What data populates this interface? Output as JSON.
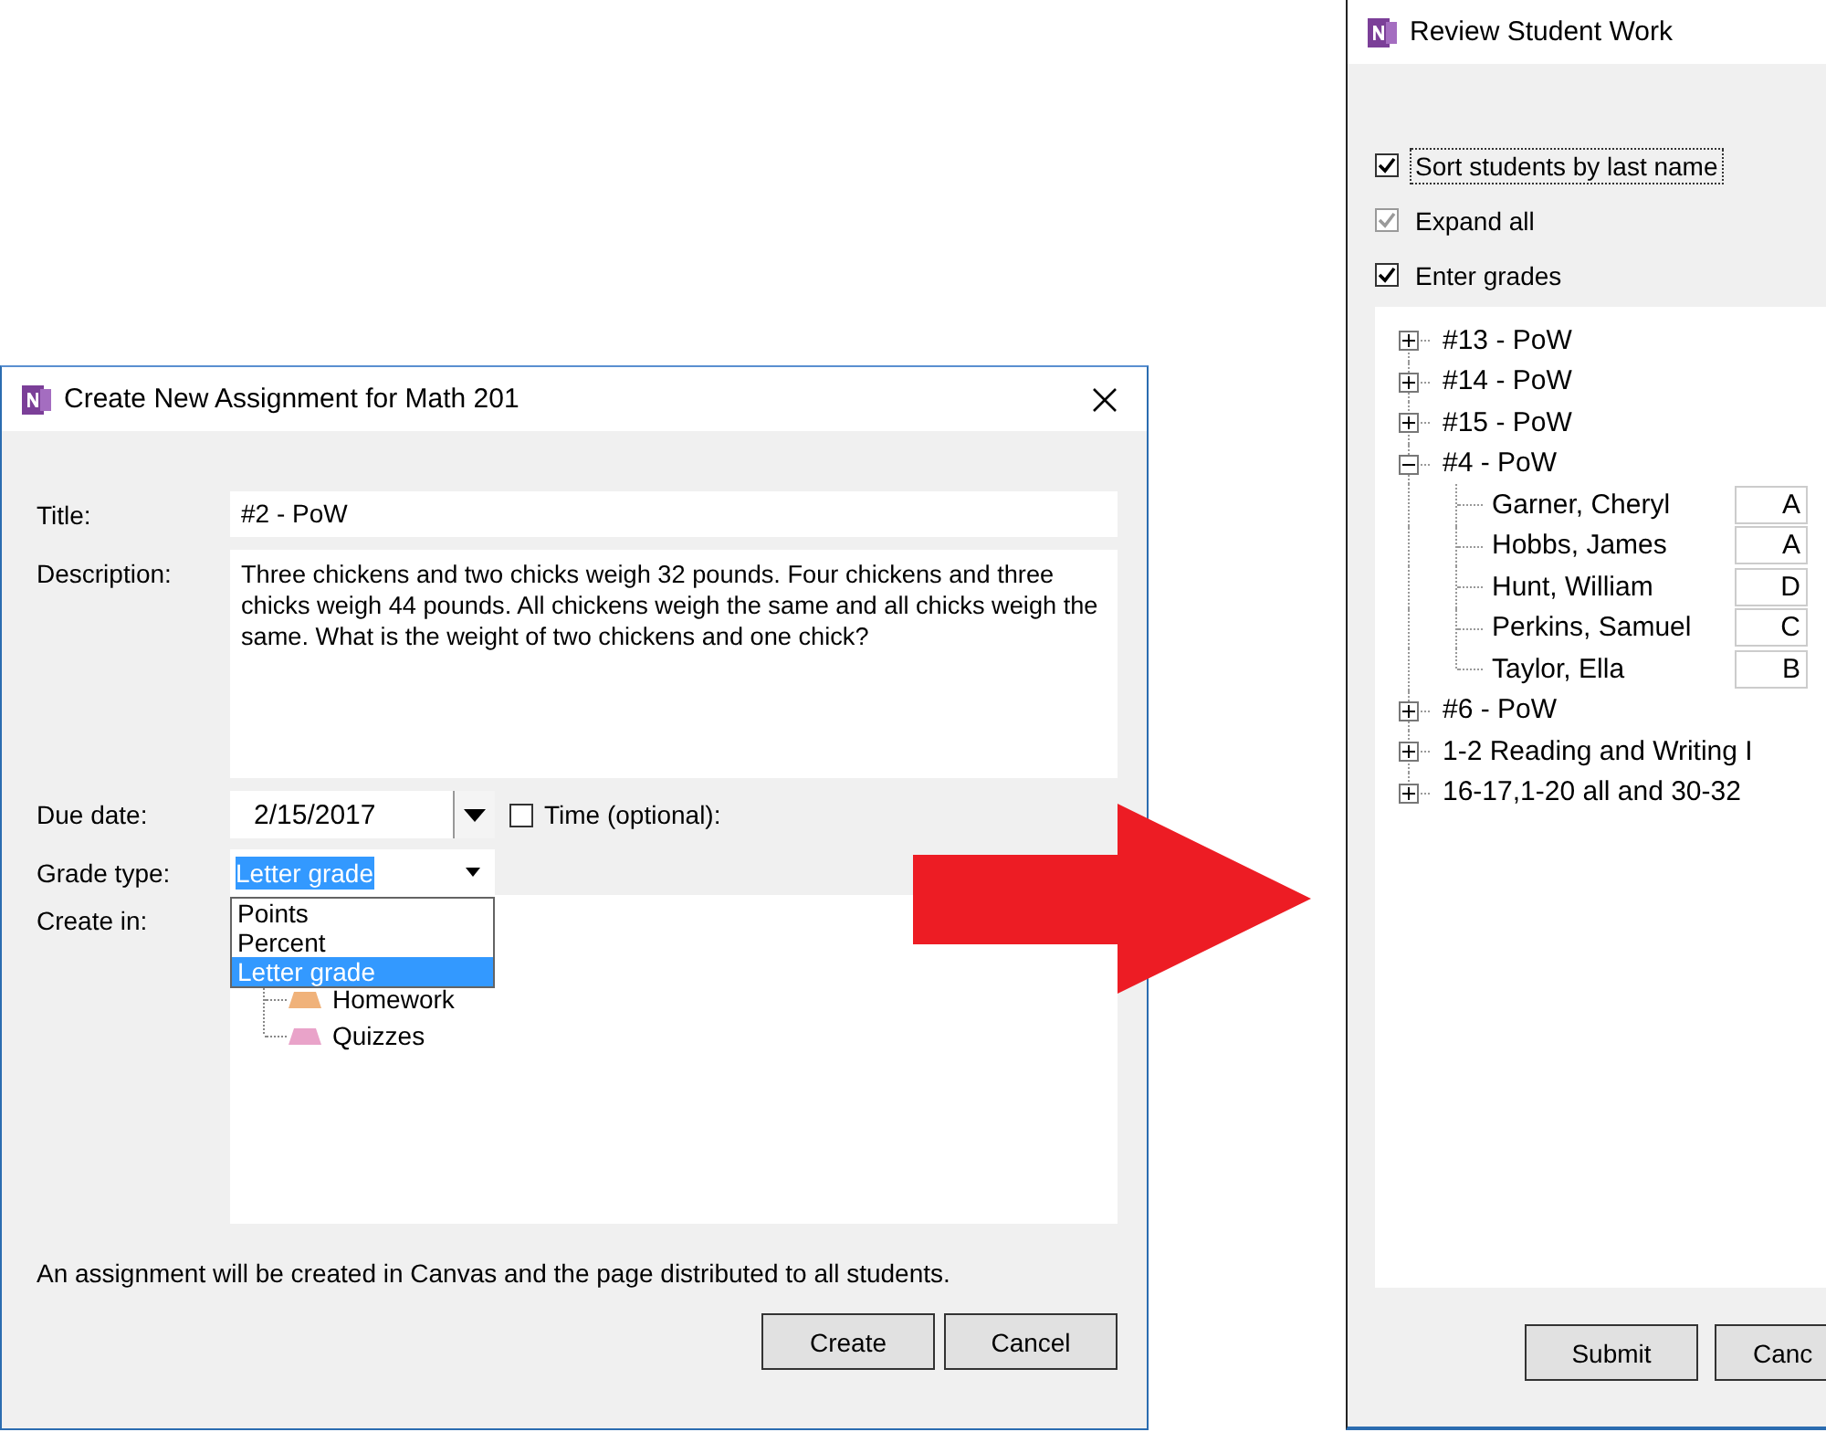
{
  "create_dialog": {
    "title": "Create New Assignment for Math 201",
    "title_label": "Title:",
    "title_value": "#2 - PoW",
    "description_label": "Description:",
    "description_value": "Three chickens and two chicks weigh 32 pounds. Four chickens and three chicks weigh 44 pounds. All chickens weigh the same and all chicks weigh the same. What is the weight of two chickens and one chick?",
    "due_date_label": "Due date:",
    "due_date_value": "2/15/2017",
    "time_checkbox": {
      "label": "Time (optional):",
      "checked": false
    },
    "grade_type_label": "Grade type:",
    "grade_type": {
      "value": "Letter grade",
      "text_highlighted": true,
      "expanded": true,
      "options": [
        {
          "label": "Points",
          "selected": false
        },
        {
          "label": "Percent",
          "selected": false
        },
        {
          "label": "Letter grade",
          "selected": true
        }
      ]
    },
    "create_in_label": "Create in:",
    "create_in_tree": [
      {
        "label": "Homework",
        "color": "#f0b27a"
      },
      {
        "label": "Quizzes",
        "color": "#e9a3c9"
      }
    ],
    "note": "An assignment will be created in Canvas and the page distributed to all students.",
    "buttons": [
      "Create",
      "Cancel"
    ]
  },
  "review_dialog": {
    "title": "Review Student Work",
    "options": [
      {
        "label": "Sort students by last name",
        "checked": true,
        "disabled": false,
        "focused": true
      },
      {
        "label": "Expand all",
        "checked": true,
        "disabled": true,
        "focused": false
      },
      {
        "label": "Enter grades",
        "checked": true,
        "disabled": false,
        "focused": false
      }
    ],
    "tree": [
      {
        "label": "#13 - PoW",
        "expanded": false
      },
      {
        "label": "#14 - PoW",
        "expanded": false
      },
      {
        "label": "#15 - PoW",
        "expanded": false
      },
      {
        "label": "#4 - PoW",
        "expanded": true,
        "children": [
          {
            "name": "Garner, Cheryl",
            "grade": "A"
          },
          {
            "name": "Hobbs, James",
            "grade": "A"
          },
          {
            "name": "Hunt, William",
            "grade": "D"
          },
          {
            "name": "Perkins, Samuel",
            "grade": "C"
          },
          {
            "name": "Taylor, Ella",
            "grade": "B"
          }
        ]
      },
      {
        "label": "#6 - PoW",
        "expanded": false
      },
      {
        "label": "1-2 Reading and Writing I",
        "expanded": false
      },
      {
        "label": "16-17,1-20 all and 30-32",
        "expanded": false
      }
    ],
    "buttons": [
      "Submit",
      "Canc"
    ]
  }
}
